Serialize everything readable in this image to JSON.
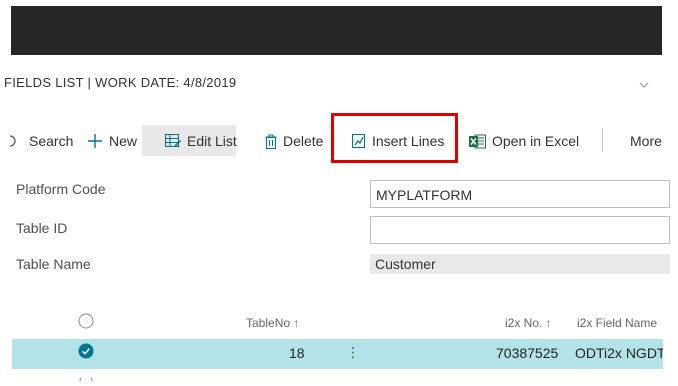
{
  "page": {
    "title": "FIELDS LIST | WORK DATE: 4/8/2019"
  },
  "toolbar": {
    "search": "Search",
    "new": "New",
    "edit_list": "Edit List",
    "delete": "Delete",
    "insert_lines": "Insert Lines",
    "open_in_excel": "Open in Excel",
    "more": "More"
  },
  "fields": [
    {
      "label": "Platform Code",
      "value": "MYPLATFORM"
    },
    {
      "label": "Table ID",
      "value": ""
    },
    {
      "label": "Table Name",
      "value": "Customer"
    }
  ],
  "table": {
    "columns": {
      "table_no": "TableNo ↑",
      "i2x_no": "i2x No. ↑",
      "i2x_field_name": "i2x Field Name"
    },
    "rows": [
      {
        "selected": true,
        "table_no": "18",
        "menu": "⋮",
        "i2x_no": "70387525",
        "i2x_field_name": "ODTi2x NGDT"
      }
    ]
  },
  "colors": {
    "topbar": "#262626",
    "selected_row": "#b2e3e8",
    "highlight_box": "#e00000",
    "accent": "#00758f"
  }
}
